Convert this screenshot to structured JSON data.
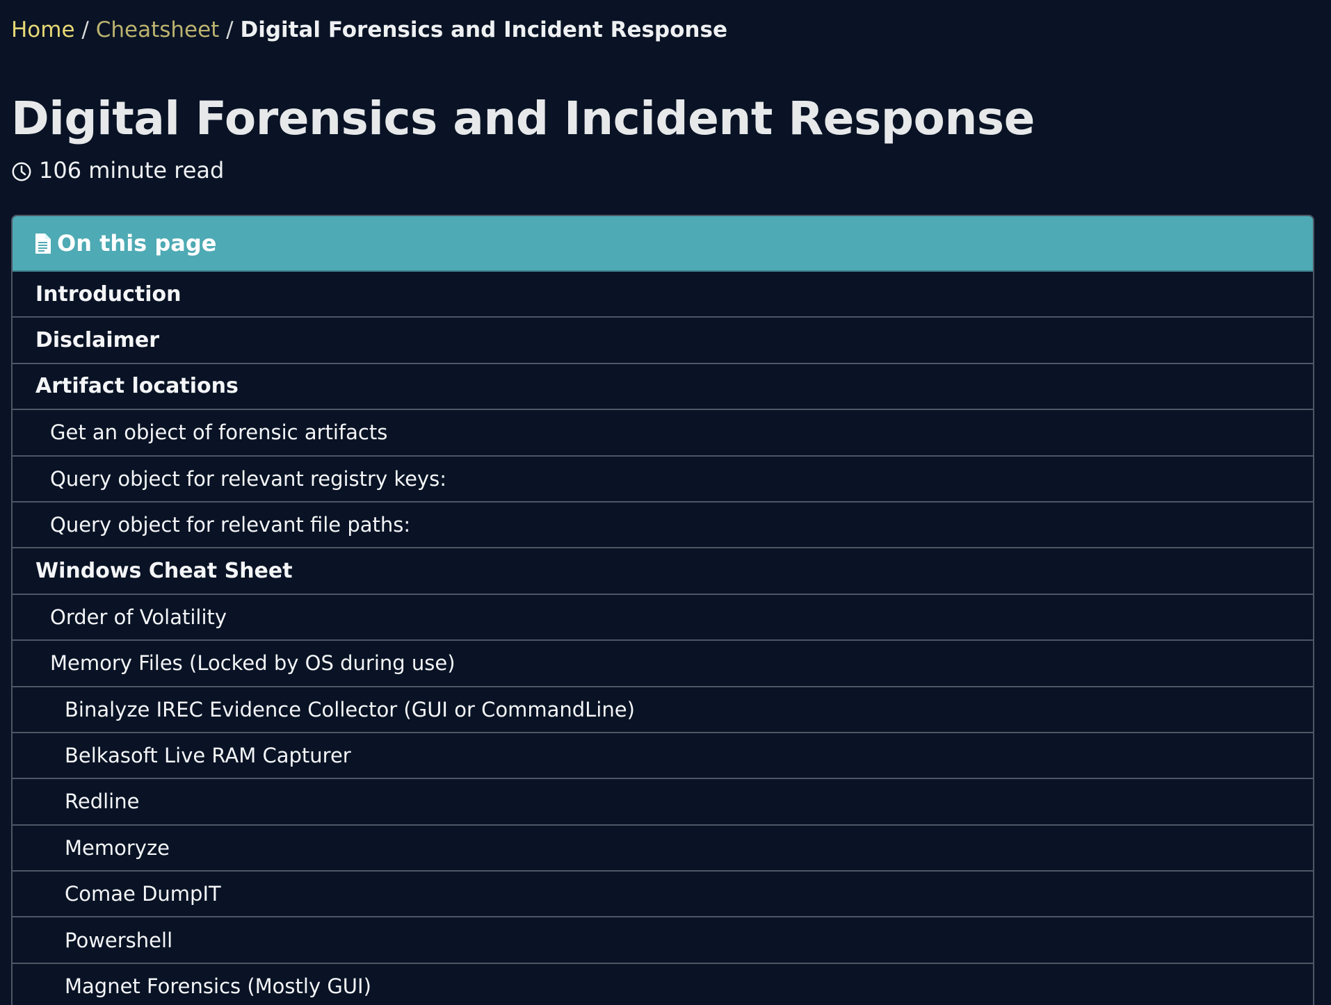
{
  "breadcrumb": {
    "home": "Home",
    "cheatsheet": "Cheatsheet",
    "current": "Digital Forensics and Incident Response",
    "separator": " / "
  },
  "page": {
    "title": "Digital Forensics and Incident Response",
    "read_time": "106 minute read"
  },
  "toc": {
    "header": "On this page",
    "items": [
      {
        "label": "Introduction",
        "level": 1
      },
      {
        "label": "Disclaimer",
        "level": 1
      },
      {
        "label": "Artifact locations",
        "level": 1
      },
      {
        "label": "Get an object of forensic artifacts",
        "level": 2
      },
      {
        "label": "Query object for relevant registry keys:",
        "level": 2
      },
      {
        "label": "Query object for relevant file paths:",
        "level": 2
      },
      {
        "label": "Windows Cheat Sheet",
        "level": 1
      },
      {
        "label": "Order of Volatility",
        "level": 2
      },
      {
        "label": "Memory Files (Locked by OS during use)",
        "level": 2
      },
      {
        "label": "Binalyze IREC Evidence Collector (GUI or CommandLine)",
        "level": 3
      },
      {
        "label": "Belkasoft Live RAM Capturer",
        "level": 3
      },
      {
        "label": "Redline",
        "level": 3
      },
      {
        "label": "Memoryze",
        "level": 3
      },
      {
        "label": "Comae DumpIT",
        "level": 3
      },
      {
        "label": "Powershell",
        "level": 3
      },
      {
        "label": "Magnet Forensics (Mostly GUI)",
        "level": 3
      }
    ]
  },
  "colors": {
    "background": "#091325",
    "toc_header": "#4eaab4",
    "breadcrumb_home": "#e7d875",
    "breadcrumb_cheatsheet": "#bcb36f"
  },
  "icons": {
    "read_time": "clock-icon",
    "toc_header": "document-icon"
  }
}
